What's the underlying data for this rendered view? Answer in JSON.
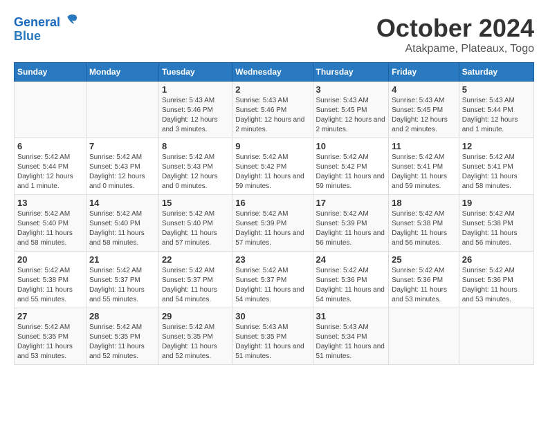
{
  "header": {
    "logo_line1": "General",
    "logo_line2": "Blue",
    "title": "October 2024",
    "subtitle": "Atakpame, Plateaux, Togo"
  },
  "days_of_week": [
    "Sunday",
    "Monday",
    "Tuesday",
    "Wednesday",
    "Thursday",
    "Friday",
    "Saturday"
  ],
  "weeks": [
    [
      {
        "day": "",
        "info": ""
      },
      {
        "day": "",
        "info": ""
      },
      {
        "day": "1",
        "info": "Sunrise: 5:43 AM\nSunset: 5:46 PM\nDaylight: 12 hours and 3 minutes."
      },
      {
        "day": "2",
        "info": "Sunrise: 5:43 AM\nSunset: 5:46 PM\nDaylight: 12 hours and 2 minutes."
      },
      {
        "day": "3",
        "info": "Sunrise: 5:43 AM\nSunset: 5:45 PM\nDaylight: 12 hours and 2 minutes."
      },
      {
        "day": "4",
        "info": "Sunrise: 5:43 AM\nSunset: 5:45 PM\nDaylight: 12 hours and 2 minutes."
      },
      {
        "day": "5",
        "info": "Sunrise: 5:43 AM\nSunset: 5:44 PM\nDaylight: 12 hours and 1 minute."
      }
    ],
    [
      {
        "day": "6",
        "info": "Sunrise: 5:42 AM\nSunset: 5:44 PM\nDaylight: 12 hours and 1 minute."
      },
      {
        "day": "7",
        "info": "Sunrise: 5:42 AM\nSunset: 5:43 PM\nDaylight: 12 hours and 0 minutes."
      },
      {
        "day": "8",
        "info": "Sunrise: 5:42 AM\nSunset: 5:43 PM\nDaylight: 12 hours and 0 minutes."
      },
      {
        "day": "9",
        "info": "Sunrise: 5:42 AM\nSunset: 5:42 PM\nDaylight: 11 hours and 59 minutes."
      },
      {
        "day": "10",
        "info": "Sunrise: 5:42 AM\nSunset: 5:42 PM\nDaylight: 11 hours and 59 minutes."
      },
      {
        "day": "11",
        "info": "Sunrise: 5:42 AM\nSunset: 5:41 PM\nDaylight: 11 hours and 59 minutes."
      },
      {
        "day": "12",
        "info": "Sunrise: 5:42 AM\nSunset: 5:41 PM\nDaylight: 11 hours and 58 minutes."
      }
    ],
    [
      {
        "day": "13",
        "info": "Sunrise: 5:42 AM\nSunset: 5:40 PM\nDaylight: 11 hours and 58 minutes."
      },
      {
        "day": "14",
        "info": "Sunrise: 5:42 AM\nSunset: 5:40 PM\nDaylight: 11 hours and 58 minutes."
      },
      {
        "day": "15",
        "info": "Sunrise: 5:42 AM\nSunset: 5:40 PM\nDaylight: 11 hours and 57 minutes."
      },
      {
        "day": "16",
        "info": "Sunrise: 5:42 AM\nSunset: 5:39 PM\nDaylight: 11 hours and 57 minutes."
      },
      {
        "day": "17",
        "info": "Sunrise: 5:42 AM\nSunset: 5:39 PM\nDaylight: 11 hours and 56 minutes."
      },
      {
        "day": "18",
        "info": "Sunrise: 5:42 AM\nSunset: 5:38 PM\nDaylight: 11 hours and 56 minutes."
      },
      {
        "day": "19",
        "info": "Sunrise: 5:42 AM\nSunset: 5:38 PM\nDaylight: 11 hours and 56 minutes."
      }
    ],
    [
      {
        "day": "20",
        "info": "Sunrise: 5:42 AM\nSunset: 5:38 PM\nDaylight: 11 hours and 55 minutes."
      },
      {
        "day": "21",
        "info": "Sunrise: 5:42 AM\nSunset: 5:37 PM\nDaylight: 11 hours and 55 minutes."
      },
      {
        "day": "22",
        "info": "Sunrise: 5:42 AM\nSunset: 5:37 PM\nDaylight: 11 hours and 54 minutes."
      },
      {
        "day": "23",
        "info": "Sunrise: 5:42 AM\nSunset: 5:37 PM\nDaylight: 11 hours and 54 minutes."
      },
      {
        "day": "24",
        "info": "Sunrise: 5:42 AM\nSunset: 5:36 PM\nDaylight: 11 hours and 54 minutes."
      },
      {
        "day": "25",
        "info": "Sunrise: 5:42 AM\nSunset: 5:36 PM\nDaylight: 11 hours and 53 minutes."
      },
      {
        "day": "26",
        "info": "Sunrise: 5:42 AM\nSunset: 5:36 PM\nDaylight: 11 hours and 53 minutes."
      }
    ],
    [
      {
        "day": "27",
        "info": "Sunrise: 5:42 AM\nSunset: 5:35 PM\nDaylight: 11 hours and 53 minutes."
      },
      {
        "day": "28",
        "info": "Sunrise: 5:42 AM\nSunset: 5:35 PM\nDaylight: 11 hours and 52 minutes."
      },
      {
        "day": "29",
        "info": "Sunrise: 5:42 AM\nSunset: 5:35 PM\nDaylight: 11 hours and 52 minutes."
      },
      {
        "day": "30",
        "info": "Sunrise: 5:43 AM\nSunset: 5:35 PM\nDaylight: 11 hours and 51 minutes."
      },
      {
        "day": "31",
        "info": "Sunrise: 5:43 AM\nSunset: 5:34 PM\nDaylight: 11 hours and 51 minutes."
      },
      {
        "day": "",
        "info": ""
      },
      {
        "day": "",
        "info": ""
      }
    ]
  ]
}
